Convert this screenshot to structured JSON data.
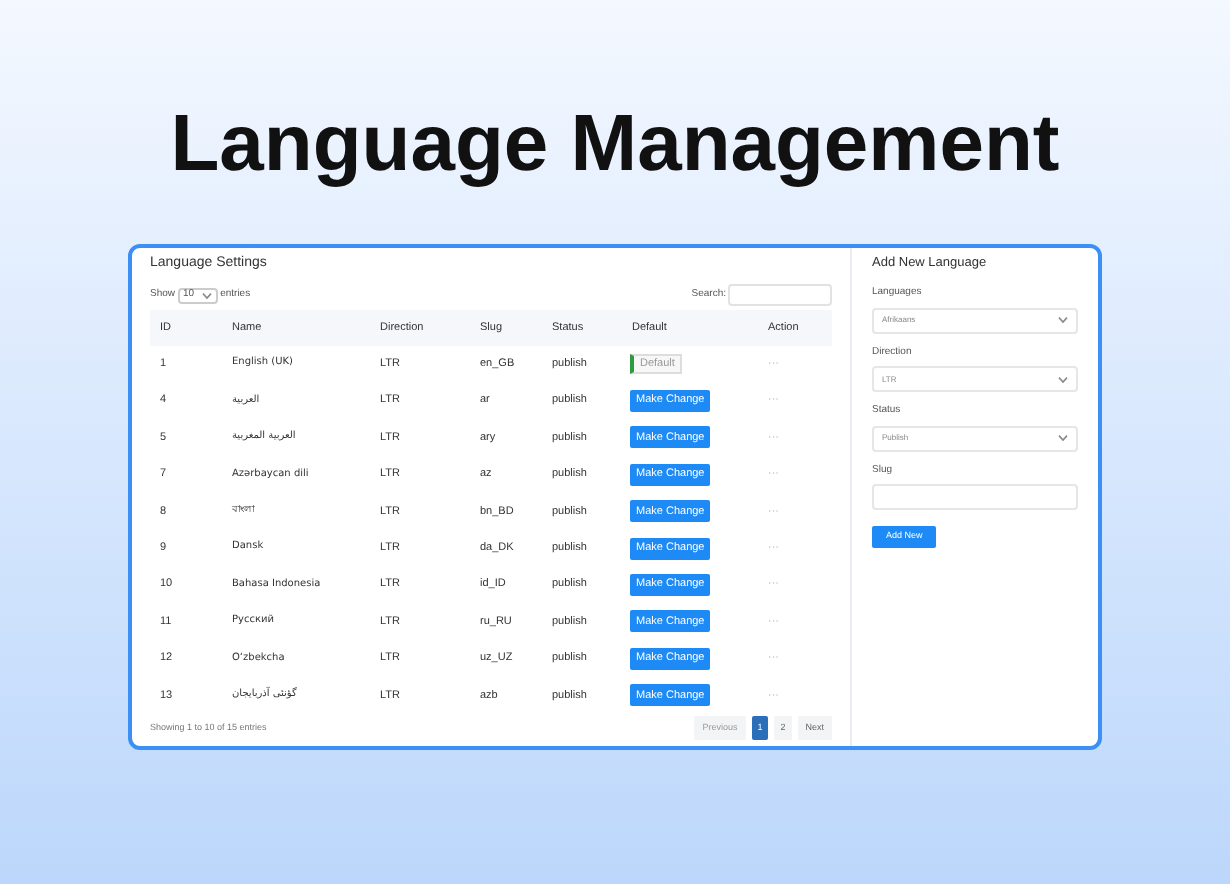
{
  "headline": "Language Management",
  "settings": {
    "title": "Language Settings",
    "show_label": "Show",
    "entries_value": "10",
    "entries_label": "entries",
    "search_label": "Search:",
    "columns": [
      "ID",
      "Name",
      "Direction",
      "Slug",
      "Status",
      "Default",
      "Action"
    ],
    "rows": [
      {
        "id": "1",
        "name": "English (UK)",
        "direction": "LTR",
        "slug": "en_GB",
        "status": "publish",
        "default": {
          "kind": "badge",
          "label": "Default"
        },
        "action": "···"
      },
      {
        "id": "4",
        "name": "العربية",
        "direction": "LTR",
        "slug": "ar",
        "status": "publish",
        "default": {
          "kind": "button",
          "label": "Make Change"
        },
        "action": "···"
      },
      {
        "id": "5",
        "name": "العربية المغربية",
        "direction": "LTR",
        "slug": "ary",
        "status": "publish",
        "default": {
          "kind": "button",
          "label": "Make Change"
        },
        "action": "···"
      },
      {
        "id": "7",
        "name": "Azərbaycan dili",
        "direction": "LTR",
        "slug": "az",
        "status": "publish",
        "default": {
          "kind": "button",
          "label": "Make Change"
        },
        "action": "···"
      },
      {
        "id": "8",
        "name": "বাংলা",
        "direction": "LTR",
        "slug": "bn_BD",
        "status": "publish",
        "default": {
          "kind": "button",
          "label": "Make Change"
        },
        "action": "···"
      },
      {
        "id": "9",
        "name": "Dansk",
        "direction": "LTR",
        "slug": "da_DK",
        "status": "publish",
        "default": {
          "kind": "button",
          "label": "Make Change"
        },
        "action": "···"
      },
      {
        "id": "10",
        "name": "Bahasa Indonesia",
        "direction": "LTR",
        "slug": "id_ID",
        "status": "publish",
        "default": {
          "kind": "button",
          "label": "Make Change"
        },
        "action": "···"
      },
      {
        "id": "11",
        "name": "Русский",
        "direction": "LTR",
        "slug": "ru_RU",
        "status": "publish",
        "default": {
          "kind": "button",
          "label": "Make Change"
        },
        "action": "···"
      },
      {
        "id": "12",
        "name": "O‘zbekcha",
        "direction": "LTR",
        "slug": "uz_UZ",
        "status": "publish",
        "default": {
          "kind": "button",
          "label": "Make Change"
        },
        "action": "···"
      },
      {
        "id": "13",
        "name": "گؤنئی آذربایجان",
        "direction": "LTR",
        "slug": "azb",
        "status": "publish",
        "default": {
          "kind": "button",
          "label": "Make Change"
        },
        "action": "···"
      }
    ],
    "footer": "Showing 1 to 10 of 15 entries",
    "pagination": [
      {
        "label": "Previous",
        "selected": false,
        "disabled": true
      },
      {
        "label": "1",
        "selected": true,
        "disabled": false
      },
      {
        "label": "2",
        "selected": false,
        "disabled": false
      },
      {
        "label": "Next",
        "selected": false,
        "disabled": false
      }
    ]
  },
  "add_form": {
    "title": "Add New Language",
    "fields": [
      {
        "kind": "select",
        "label": "Languages",
        "value": "Afrikaans"
      },
      {
        "kind": "select",
        "label": "Direction",
        "value": "LTR"
      },
      {
        "kind": "select",
        "label": "Status",
        "value": "Publish"
      },
      {
        "kind": "text",
        "label": "Slug"
      }
    ],
    "submit": "Add New"
  }
}
